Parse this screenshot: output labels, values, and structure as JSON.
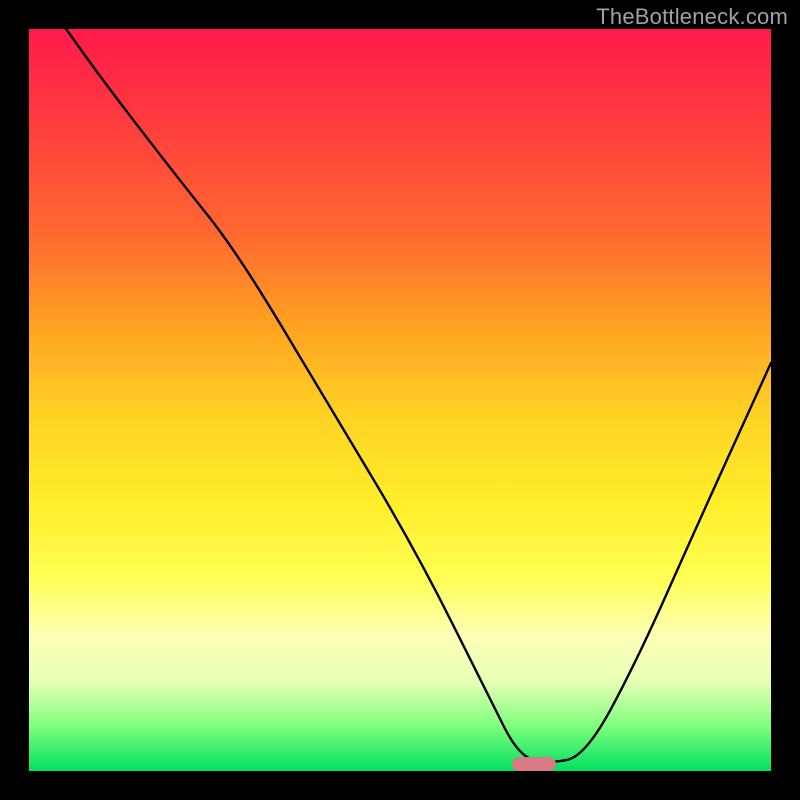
{
  "watermark": "TheBottleneck.com",
  "chart_data": {
    "type": "line",
    "title": "",
    "xlabel": "",
    "ylabel": "",
    "xlim": [
      0,
      100
    ],
    "ylim": [
      0,
      100
    ],
    "series": [
      {
        "name": "curve",
        "x": [
          5,
          10,
          20,
          28,
          40,
          52,
          62,
          66,
          70,
          75,
          82,
          90,
          100
        ],
        "values": [
          100,
          93,
          80,
          70,
          50,
          30,
          10,
          2,
          1,
          2,
          15,
          33,
          55
        ]
      }
    ],
    "marker": {
      "x": 68,
      "y": 1,
      "color": "#d97a87"
    },
    "background_gradient": {
      "direction": "vertical",
      "stops": [
        {
          "pos": 0.0,
          "color": "#ff1a4b"
        },
        {
          "pos": 0.12,
          "color": "#ff3a3f"
        },
        {
          "pos": 0.28,
          "color": "#ff6a2f"
        },
        {
          "pos": 0.4,
          "color": "#ffa222"
        },
        {
          "pos": 0.52,
          "color": "#ffd224"
        },
        {
          "pos": 0.64,
          "color": "#ffee2a"
        },
        {
          "pos": 0.74,
          "color": "#ffff55"
        },
        {
          "pos": 0.82,
          "color": "#feffb8"
        },
        {
          "pos": 0.88,
          "color": "#e6ffb4"
        },
        {
          "pos": 0.94,
          "color": "#7dff7d"
        },
        {
          "pos": 1.0,
          "color": "#00e060"
        }
      ]
    }
  }
}
